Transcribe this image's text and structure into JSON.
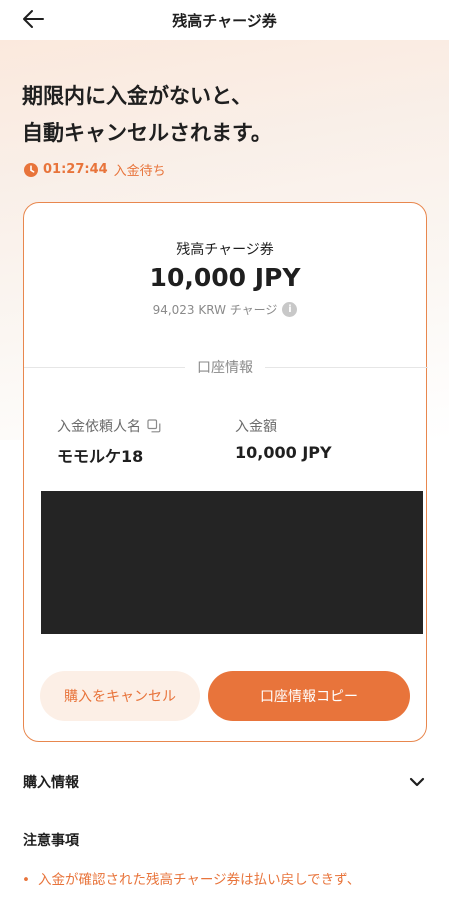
{
  "header": {
    "title": "残高チャージ券",
    "back_icon": "arrow-left-icon"
  },
  "hero": {
    "title_line1": "期限内に入金がないと、",
    "title_line2": "自動キャンセルされます。",
    "timer_time": "01:27:44",
    "timer_status": "入金待ち",
    "accent_color": "#e8743b"
  },
  "card": {
    "kind": "残高チャージ券",
    "amount": "10,000 JPY",
    "sub_amount": "94,023 KRW チャージ",
    "section_label": "口座情報",
    "fields": [
      {
        "label": "入金依頼人名",
        "value": "モモルケ18"
      },
      {
        "label": "入金額",
        "value": "10,000 JPY"
      }
    ],
    "cancel_label": "購入をキャンセル",
    "copy_label": "口座情報コピー"
  },
  "purchase_info": {
    "label": "購入情報"
  },
  "notes": {
    "title": "注意事項",
    "items": [
      "入金が確認された残高チャージ券は払い戻しできず、"
    ]
  }
}
